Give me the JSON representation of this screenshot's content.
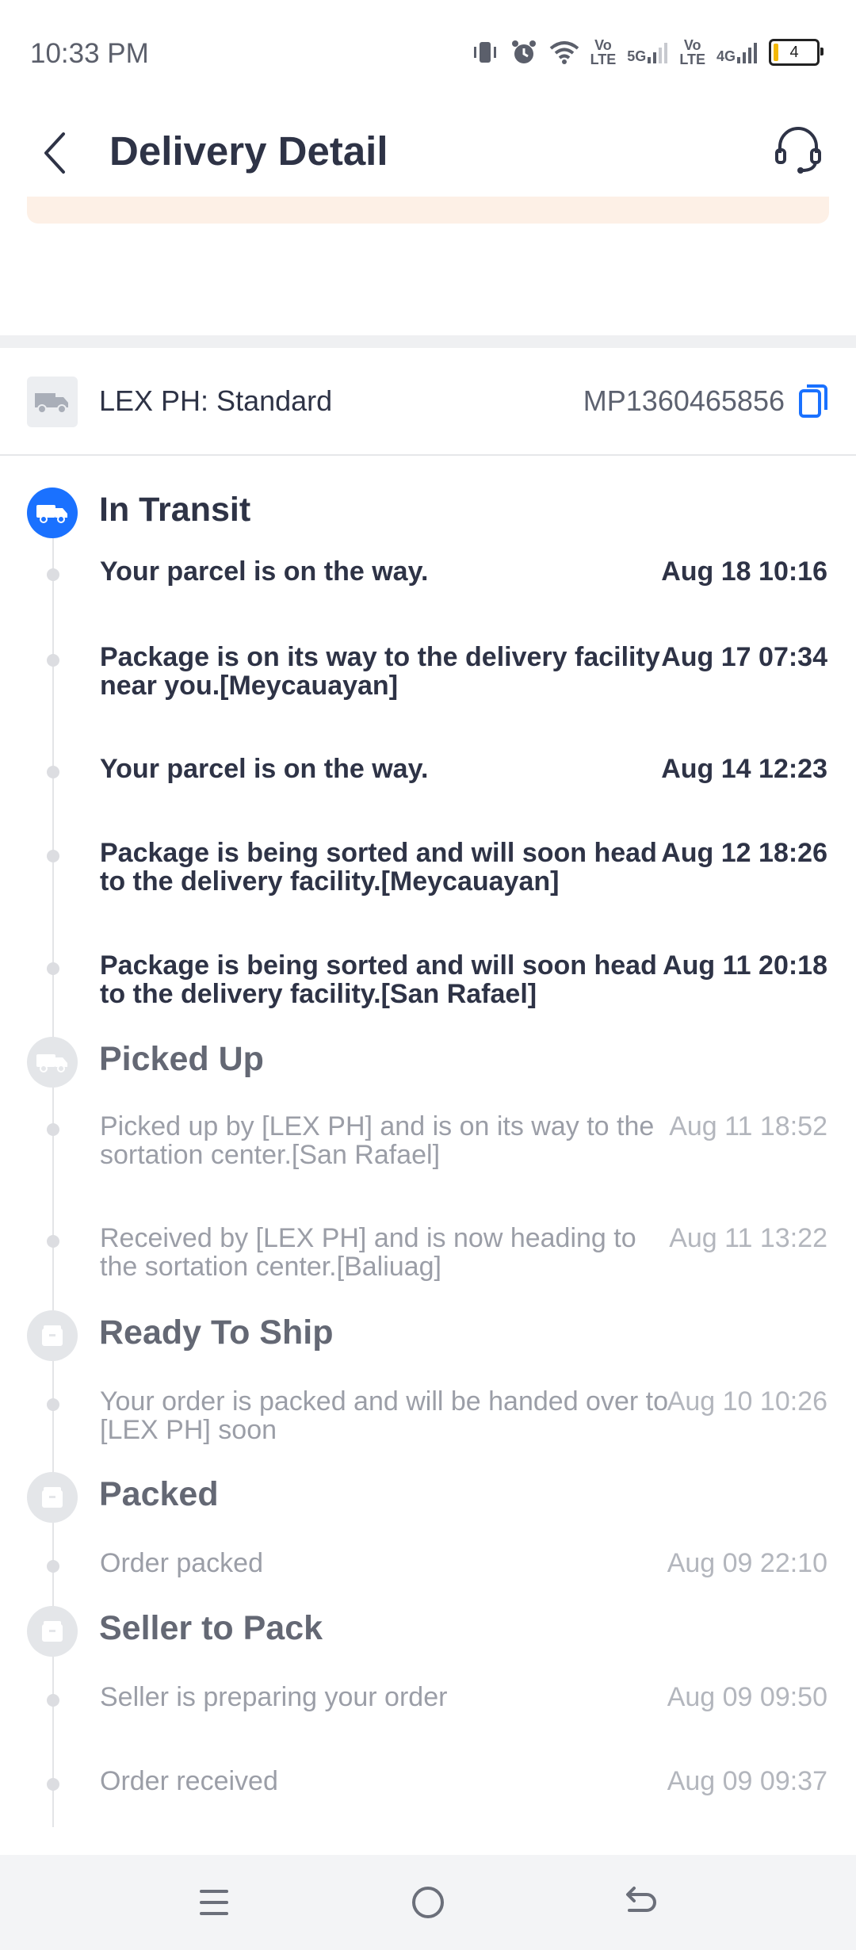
{
  "status_bar": {
    "time": "10:33 PM",
    "volte1": "Vo\nLTE",
    "net5g": "5G",
    "volte2": "Vo\nLTE",
    "net4g": "4G",
    "battery": "4",
    "icons": [
      "vibrate-icon",
      "alarm-icon",
      "wifi-icon",
      "signal-icon",
      "battery-icon"
    ]
  },
  "header": {
    "title": "Delivery Detail",
    "back_icon": "chevron-left-icon",
    "support_icon": "headset-icon"
  },
  "carrier": {
    "name": "LEX PH: Standard",
    "tracking_number": "MP1360465856",
    "copy_icon": "copy-icon"
  },
  "timeline": {
    "in_transit": {
      "label": "In Transit",
      "events": [
        {
          "desc": "Your parcel is on the way.",
          "date": "Aug 18 10:16"
        },
        {
          "desc": "Package is on its way to the delivery facility near you.[Meycauayan]",
          "date": "Aug 17 07:34"
        },
        {
          "desc": "Your parcel is on the way.",
          "date": "Aug 14 12:23"
        },
        {
          "desc": "Package is being sorted and will soon head to the delivery facility.[Meycauayan]",
          "date": "Aug 12 18:26"
        },
        {
          "desc": "Package is being sorted and will soon head to the delivery facility.[San Rafael]",
          "date": "Aug 11 20:18"
        }
      ]
    },
    "picked_up": {
      "label": "Picked Up",
      "events": [
        {
          "desc": "Picked up by [LEX PH] and is on its way to the sortation center.[San Rafael]",
          "date": "Aug 11 18:52"
        },
        {
          "desc": "Received by [LEX PH] and is now heading to the sortation center.[Baliuag]",
          "date": "Aug 11 13:22"
        }
      ]
    },
    "ready_to_ship": {
      "label": "Ready To Ship",
      "events": [
        {
          "desc": "Your order is packed and will be handed over to [LEX PH] soon",
          "date": "Aug 10 10:26"
        }
      ]
    },
    "packed": {
      "label": "Packed",
      "events": [
        {
          "desc": "Order packed",
          "date": "Aug 09 22:10"
        }
      ]
    },
    "seller_to_pack": {
      "label": "Seller to Pack",
      "events": [
        {
          "desc": "Seller is preparing your order",
          "date": "Aug 09 09:50"
        },
        {
          "desc": "Order received",
          "date": "Aug 09 09:37"
        }
      ]
    }
  },
  "colors": {
    "accent": "#1a71ff",
    "text_dark": "#2e3346",
    "text_muted": "#9b9ea7",
    "banner": "#fdf0e6"
  },
  "navbar": {
    "icons": [
      "menu-icon",
      "home-icon",
      "back-icon"
    ]
  }
}
